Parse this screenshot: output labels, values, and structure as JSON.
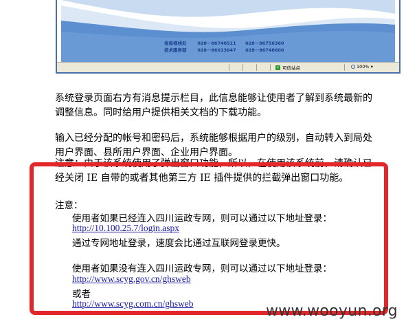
{
  "screenshot": {
    "contacts": [
      {
        "label": "省局视线处",
        "phone1": "028－86740511",
        "phone2": "028－86756360"
      },
      {
        "label": "技术服务部",
        "phone1": "028－86613647",
        "phone2": "028－86748600"
      }
    ],
    "status_zone": "可信站点",
    "status_zoom": "100%",
    "colors": {
      "wave": "#5b8fd0",
      "wave_light": "#c9dbf1"
    }
  },
  "document": {
    "para1": "系统登录页面右方有消息提示栏目，此信息能够让使用者了解到系统最新的调整信息。同时给用户提供相关文档的下载功能。",
    "para1_line1": "系统登录页面右方有消息提示栏目，此信息能够让使用者了解到系统最新的",
    "para1_line2": "调整信息。同时给用户提供相关文档的下载功能。",
    "para2_line1": "输入已经分配的帐号和密码后，系统能够根据用户的级别，自动转入到局处",
    "para2_line2": "用户界面、县所用户界面、企业用户界面。",
    "para3_line1": "注意：由于该系统使用了弹出窗口功能，所以，在使用该系统前，请确认已",
    "para3_line2": "经关闭 IE 自带的或者其他第三方 IE 插件提供的拦截弹出窗口功能。",
    "note_title": "注意：",
    "note_line1": "使用者如果已经连入四川运政专网，则可以通过以下地址登录：",
    "note_link1": "http://10.100.25.7/login.aspx",
    "note_line2": "通过专网地址登录，速度会比通过互联网登录更快。",
    "note_line3": "使用者如果没有连入四川运政专网，则可以通过以下地址登录：",
    "note_link2": "http://www.scyg.gov.cn/ghsweb",
    "note_or": "或者",
    "note_link3": "http://www.scyg.com.cn/ghsweb"
  },
  "watermark": "www.wooyun.org"
}
